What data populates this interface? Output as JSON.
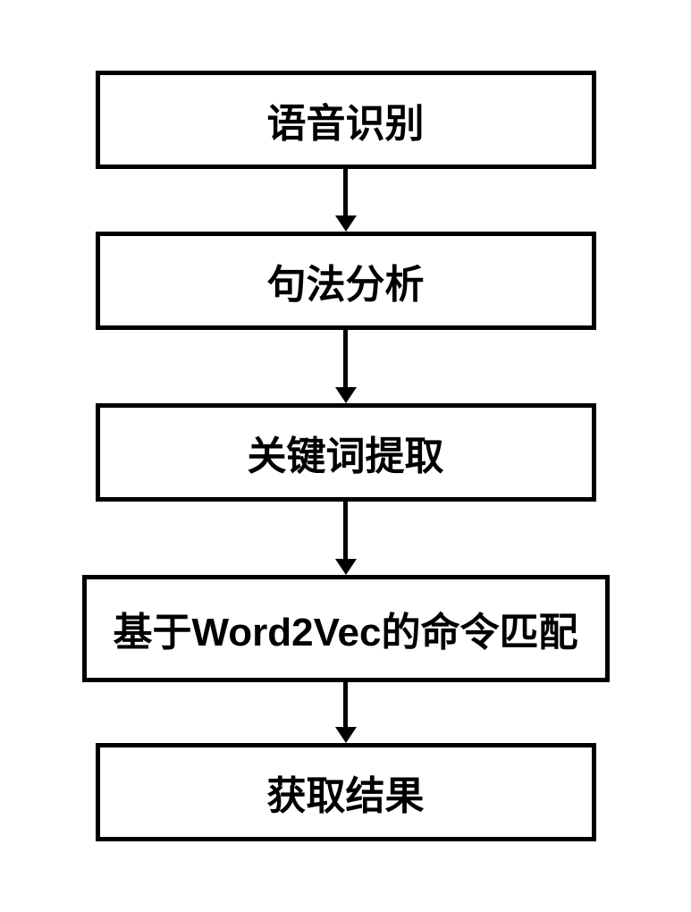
{
  "chart_data": {
    "type": "flowchart",
    "direction": "top-to-bottom",
    "title": "",
    "nodes": [
      {
        "id": "n1",
        "label": "语音识别"
      },
      {
        "id": "n2",
        "label": "句法分析"
      },
      {
        "id": "n3",
        "label": "关键词提取"
      },
      {
        "id": "n4",
        "label": "基于Word2Vec的命令匹配"
      },
      {
        "id": "n5",
        "label": "获取结果"
      }
    ],
    "edges": [
      {
        "from": "n1",
        "to": "n2"
      },
      {
        "from": "n2",
        "to": "n3"
      },
      {
        "from": "n3",
        "to": "n4"
      },
      {
        "from": "n4",
        "to": "n5"
      }
    ]
  }
}
